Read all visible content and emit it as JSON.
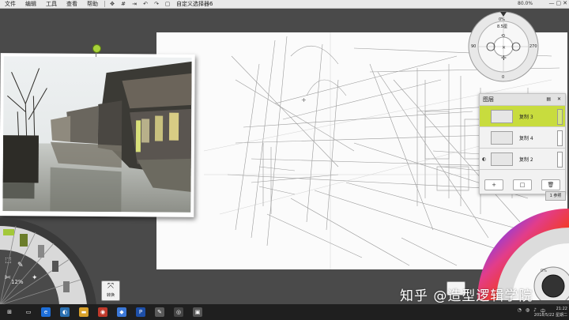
{
  "menu": {
    "items": [
      "文件",
      "编辑",
      "工具",
      "查看",
      "帮助"
    ],
    "doc_title": "自定义选择器6",
    "zoom_readout": "80.0%"
  },
  "rose": {
    "top_label": "0%",
    "size_label": "8.5厘",
    "left_label": "90",
    "right_label": "270",
    "bottom_label": "0"
  },
  "layers": {
    "title": "图层",
    "items": [
      {
        "name": "复制 3",
        "selected": true
      },
      {
        "name": "复制 4",
        "selected": false
      },
      {
        "name": "复制 2",
        "selected": false
      }
    ],
    "footer_buttons": [
      "+",
      "□",
      "🗑"
    ],
    "ref_label": "1 参照"
  },
  "toolwheel": {
    "zoom": "12%",
    "transform_label": "转换"
  },
  "colorwheel": {
    "accent": "#c8dc3e"
  },
  "watermark": "知乎 @造型逻辑学院",
  "taskbar": {
    "time": "21:22",
    "date": "2018/5/22 星期二"
  }
}
